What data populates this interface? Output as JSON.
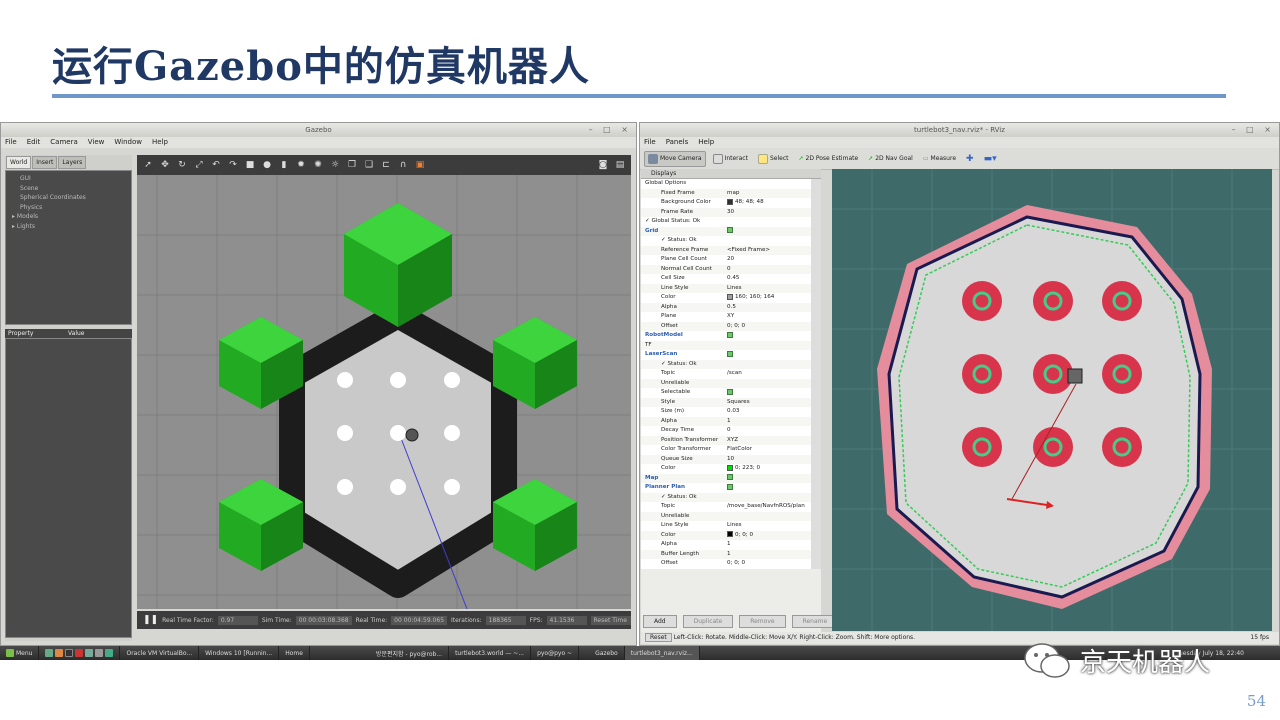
{
  "slide": {
    "title": "运行Gazebo中的仿真机器人",
    "page_number": "54",
    "watermark": "京天机器人"
  },
  "gazebo": {
    "window_title": "Gazebo",
    "menu": [
      "File",
      "Edit",
      "Camera",
      "View",
      "Window",
      "Help"
    ],
    "tabs": [
      "World",
      "Insert",
      "Layers"
    ],
    "tree": [
      "GUI",
      "Scene",
      "Spherical Coordinates",
      "Physics",
      "Models",
      "Lights"
    ],
    "property_headers": [
      "Property",
      "Value"
    ],
    "bottom": {
      "rtf_label": "Real Time Factor:",
      "rtf": "0.97",
      "sim_label": "Sim Time:",
      "sim": "00 00:03:08.368",
      "real_label": "Real Time:",
      "real": "00 00:04:59.065",
      "iter_label": "Iterations:",
      "iter": "188365",
      "fps_label": "FPS:",
      "fps": "41.1536",
      "reset": "Reset Time"
    }
  },
  "rviz": {
    "window_title": "turtlebot3_nav.rviz* - RViz",
    "menu": [
      "File",
      "Panels",
      "Help"
    ],
    "tools": [
      "Move Camera",
      "Interact",
      "Select",
      "2D Pose Estimate",
      "2D Nav Goal",
      "Measure"
    ],
    "displays_header": "Displays",
    "rows": [
      {
        "k": "Global Options",
        "v": "",
        "indent": 1,
        "hl": false
      },
      {
        "k": "Fixed Frame",
        "v": "map",
        "indent": 2
      },
      {
        "k": "Background Color",
        "v": "48; 48; 48",
        "indent": 2,
        "sw": "#303030"
      },
      {
        "k": "Frame Rate",
        "v": "30",
        "indent": 2
      },
      {
        "k": "✓ Global Status: Ok",
        "v": "",
        "indent": 1
      },
      {
        "k": "Grid",
        "v": "",
        "indent": 1,
        "hl": true,
        "chk": true
      },
      {
        "k": "✓ Status: Ok",
        "v": "",
        "indent": 2
      },
      {
        "k": "Reference Frame",
        "v": "<Fixed Frame>",
        "indent": 2
      },
      {
        "k": "Plane Cell Count",
        "v": "20",
        "indent": 2
      },
      {
        "k": "Normal Cell Count",
        "v": "0",
        "indent": 2
      },
      {
        "k": "Cell Size",
        "v": "0.45",
        "indent": 2
      },
      {
        "k": "Line Style",
        "v": "Lines",
        "indent": 2
      },
      {
        "k": "Color",
        "v": "160; 160; 164",
        "indent": 2,
        "sw": "#a0a0a4"
      },
      {
        "k": "Alpha",
        "v": "0.5",
        "indent": 2
      },
      {
        "k": "Plane",
        "v": "XY",
        "indent": 2
      },
      {
        "k": "Offset",
        "v": "0; 0; 0",
        "indent": 2
      },
      {
        "k": "RobotModel",
        "v": "",
        "indent": 1,
        "hl": true,
        "chk": true
      },
      {
        "k": "TF",
        "v": "",
        "indent": 1
      },
      {
        "k": "LaserScan",
        "v": "",
        "indent": 1,
        "hl": true,
        "chk": true
      },
      {
        "k": "✓ Status: Ok",
        "v": "",
        "indent": 2
      },
      {
        "k": "Topic",
        "v": "/scan",
        "indent": 2
      },
      {
        "k": "Unreliable",
        "v": "",
        "indent": 2
      },
      {
        "k": "Selectable",
        "v": "",
        "indent": 2,
        "chk": true
      },
      {
        "k": "Style",
        "v": "Squares",
        "indent": 2
      },
      {
        "k": "Size (m)",
        "v": "0.03",
        "indent": 2
      },
      {
        "k": "Alpha",
        "v": "1",
        "indent": 2
      },
      {
        "k": "Decay Time",
        "v": "0",
        "indent": 2
      },
      {
        "k": "Position Transformer",
        "v": "XYZ",
        "indent": 2
      },
      {
        "k": "Color Transformer",
        "v": "FlatColor",
        "indent": 2
      },
      {
        "k": "Queue Size",
        "v": "10",
        "indent": 2
      },
      {
        "k": "Color",
        "v": "0; 223; 0",
        "indent": 2,
        "sw": "#00df00"
      },
      {
        "k": "Map",
        "v": "",
        "indent": 1,
        "hl": true,
        "chk": true
      },
      {
        "k": "Planner Plan",
        "v": "",
        "indent": 1,
        "hl": true,
        "chk": true
      },
      {
        "k": "✓ Status: Ok",
        "v": "",
        "indent": 2
      },
      {
        "k": "Topic",
        "v": "/move_base/NavfnROS/plan",
        "indent": 2
      },
      {
        "k": "Unreliable",
        "v": "",
        "indent": 2
      },
      {
        "k": "Line Style",
        "v": "Lines",
        "indent": 2
      },
      {
        "k": "Color",
        "v": "0; 0; 0",
        "indent": 2,
        "sw": "#000000"
      },
      {
        "k": "Alpha",
        "v": "1",
        "indent": 2
      },
      {
        "k": "Buffer Length",
        "v": "1",
        "indent": 2
      },
      {
        "k": "Offset",
        "v": "0; 0; 0",
        "indent": 2
      }
    ],
    "buttons": [
      "Add",
      "Duplicate",
      "Remove",
      "Rename"
    ],
    "status": {
      "reset": "Reset",
      "hint": "Left-Click: Rotate. Middle-Click: Move X/Y. Right-Click: Zoom. Shift: More options.",
      "fps": "15 fps"
    }
  },
  "taskbar": {
    "menu": "Menu",
    "items": [
      "Oracle VM VirtualBo...",
      "Windows 10 [Runnin...",
      "Home",
      "방문편지함 - pyo@rob...",
      "turtlebot3.world — ~...",
      "pyo@pyo ~",
      "Gazebo",
      "turtlebot3_nav.rviz..."
    ],
    "clock": "Tuesday July 18, 22:40"
  }
}
